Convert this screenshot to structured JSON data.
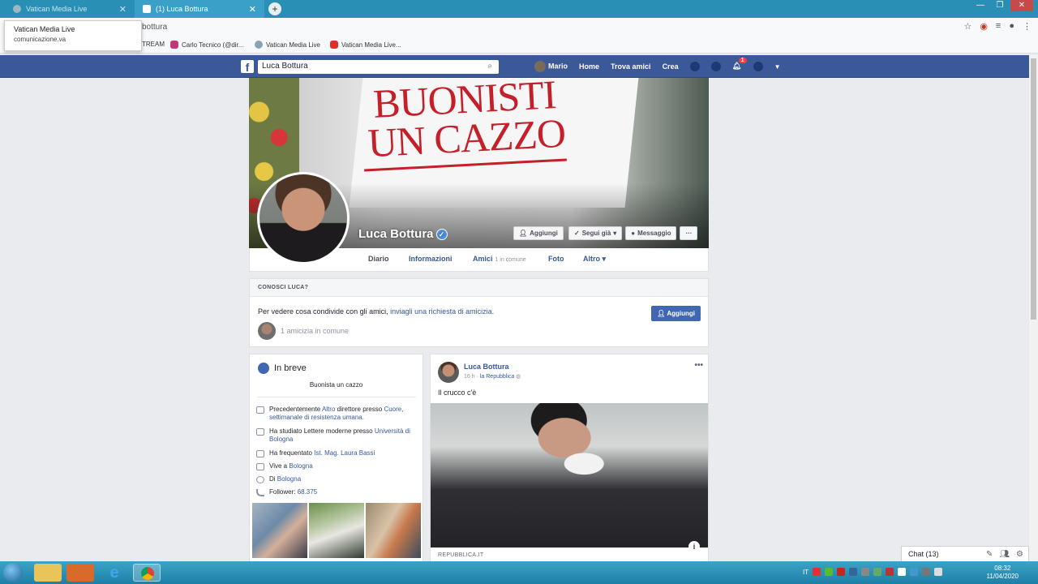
{
  "browser": {
    "tabs": [
      {
        "label": "Vatican Media Live"
      },
      {
        "label": "(1) Luca Bottura"
      }
    ],
    "new_tab": "+",
    "url_fragment": "bottura",
    "tooltip": {
      "title": "Vatican Media Live",
      "subtitle": "comunicazione.va"
    },
    "bookmarks": [
      {
        "label": "TREAM"
      },
      {
        "label": "Carlo Tecnico (@dir..."
      },
      {
        "label": "Vatican Media Live"
      },
      {
        "label": "Vatican Media Live..."
      }
    ]
  },
  "fb": {
    "logo": "f",
    "search_value": "Luca Bottura",
    "nav": {
      "user": "Mario",
      "home": "Home",
      "find_friends": "Trova amici",
      "create": "Crea",
      "notifications_count": "1"
    }
  },
  "profile": {
    "cover_headline": "BUONISTI UN CAZZO",
    "name": "Luca Bottura",
    "buttons": {
      "add": "Aggiungi",
      "follow": "Segui già",
      "message": "Messaggio",
      "more": "···"
    },
    "tabs": {
      "timeline": "Diario",
      "about": "Informazioni",
      "friends": "Amici",
      "friends_sub": "1 in comune",
      "photos": "Foto",
      "more": "Altro"
    }
  },
  "know": {
    "header": "CONOSCI LUCA?",
    "message_prefix": "Per vedere cosa condivide con gli amici,",
    "message_link": "inviagli una richiesta di amicizia.",
    "add_button": "Aggiungi",
    "mutual": "1 amicizia in comune"
  },
  "intro": {
    "title": "In breve",
    "bio": "Buonista un cazzo",
    "items": [
      {
        "pre": "Precedentemente",
        "link1": "Altro",
        "mid": "direttore presso",
        "link2": "Cuore, settimanale di resistenza umana."
      },
      {
        "pre": "Ha studiato Lettere moderne presso",
        "link": "Università di Bologna"
      },
      {
        "pre": "Ha frequentato",
        "link": "Ist. Mag. Laura Bassi"
      },
      {
        "pre": "Vive a",
        "link": "Bologna"
      },
      {
        "pre": "Di",
        "link": "Bologna"
      },
      {
        "pre": "Follower:",
        "link": "68.375"
      }
    ]
  },
  "post": {
    "author": "Luca Bottura",
    "time": "16 h",
    "via": "la Repubblica",
    "text": "Il crucco c'è",
    "source": "REPUBBLICA.IT",
    "more": "•••",
    "info": "i"
  },
  "chat": {
    "label": "Chat (13)"
  },
  "taskbar": {
    "lang": "IT",
    "time": "08:32",
    "date": "11/04/2020"
  }
}
